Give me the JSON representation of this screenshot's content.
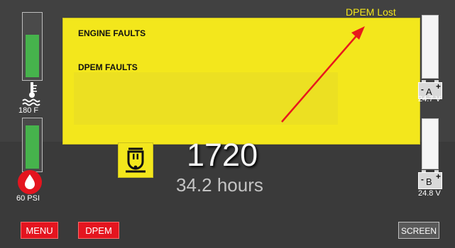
{
  "status": {
    "text": "DPEM Lost"
  },
  "faults": {
    "engine_heading": "ENGINE FAULTS",
    "dpem_heading": "DPEM FAULTS"
  },
  "engine": {
    "rpm": "1720",
    "hours": "34.2 hours"
  },
  "gauges": {
    "coolant": {
      "label": "180 F",
      "level": 0.5,
      "icon": "coolant-temperature-icon"
    },
    "oil": {
      "label": "60 PSI",
      "level": 0.72,
      "icon": "oil-pressure-icon"
    }
  },
  "batteries": {
    "a": {
      "letter": "A",
      "voltage": "24.7 V",
      "level": 0.0
    },
    "b": {
      "letter": "B",
      "voltage": "24.8 V",
      "level": 0.0
    }
  },
  "buttons": {
    "menu": "MENU",
    "dpem": "DPEM",
    "screen": "SCREEN"
  },
  "colors": {
    "fault_panel": "#f3e71c",
    "gauge_fill": "#46b34c",
    "button_red": "#e4151f",
    "annotation_arrow": "#e8191c"
  },
  "minus_sign": "-",
  "plus_sign": "+"
}
